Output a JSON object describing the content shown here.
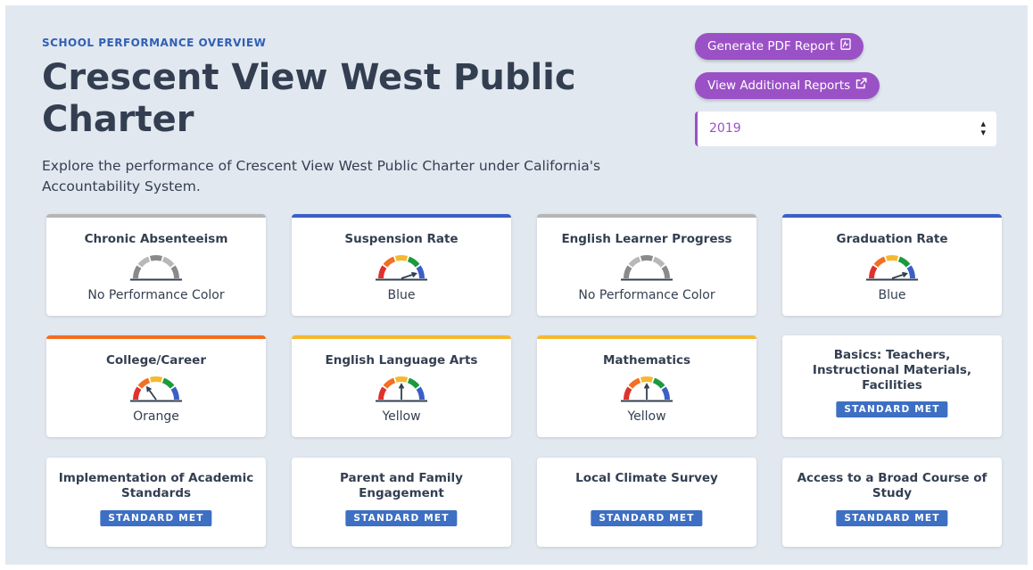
{
  "header": {
    "eyebrow": "SCHOOL PERFORMANCE OVERVIEW",
    "title": "Crescent View West Public Charter",
    "description": "Explore the performance of Crescent View West Public Charter under California's Accountability System."
  },
  "actions": {
    "pdf_label": "Generate PDF Report",
    "pdf_icon": "pdf-file-icon",
    "reports_label": "View Additional Reports",
    "reports_icon": "external-link-icon",
    "accent_color": "#9b51c6"
  },
  "year_select": {
    "value": "2019",
    "icon": "sort-arrows-icon"
  },
  "status_colors": {
    "Red": "#e0312d",
    "Orange": "#f36f21",
    "Yellow": "#f5b82e",
    "Green": "#1b9a3e",
    "Blue": "#3a5fc6",
    "None": "#b5b5b5"
  },
  "indicators": [
    {
      "label": "Chronic Absenteeism",
      "result": "No Performance Color",
      "level": "None"
    },
    {
      "label": "Suspension Rate",
      "result": "Blue",
      "level": "Blue"
    },
    {
      "label": "English Learner Progress",
      "result": "No Performance Color",
      "level": "None"
    },
    {
      "label": "Graduation Rate",
      "result": "Blue",
      "level": "Blue"
    },
    {
      "label": "College/Career",
      "result": "Orange",
      "level": "Orange"
    },
    {
      "label": "English Language Arts",
      "result": "Yellow",
      "level": "Yellow"
    },
    {
      "label": "Mathematics",
      "result": "Yellow",
      "level": "Yellow"
    }
  ],
  "local_indicators": [
    {
      "label": "Basics: Teachers, Instructional Materials, Facilities",
      "status": "STANDARD MET"
    },
    {
      "label": "Implementation of Academic Standards",
      "status": "STANDARD MET"
    },
    {
      "label": "Parent and Family Engagement",
      "status": "STANDARD MET"
    },
    {
      "label": "Local Climate Survey",
      "status": "STANDARD MET"
    },
    {
      "label": "Access to a Broad Course of Study",
      "status": "STANDARD MET"
    }
  ]
}
